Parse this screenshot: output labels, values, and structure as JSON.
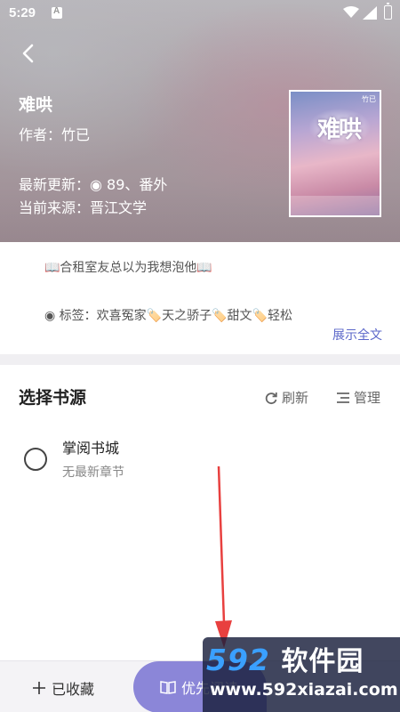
{
  "status_bar": {
    "time": "5:29"
  },
  "book": {
    "title": "难哄",
    "author_line": "作者：竹已",
    "latest_update": "最新更新：◉ 89、番外",
    "current_source": "当前来源：晋江文学",
    "cover_tag": "竹已"
  },
  "description": {
    "intro": "📖合租室友总以为我想泡他📖",
    "tags": "◉ 标签：欢喜冤家🏷️天之骄子🏷️甜文🏷️轻松",
    "expand_label": "展示全文"
  },
  "source_section": {
    "title": "选择书源",
    "refresh_label": "刷新",
    "manage_label": "管理",
    "items": [
      {
        "name": "掌阅书城",
        "chapter": "无最新章节",
        "selected": false
      }
    ]
  },
  "bottom_bar": {
    "collected_label": "已收藏",
    "read_label": "优先阅读"
  },
  "watermark": {
    "brand_number": "592",
    "brand_text": "软件园",
    "url": "www.592xiazai.com"
  },
  "colors": {
    "accent": "#8b86d8",
    "link": "#5b67c9",
    "arrow": "#e8403f"
  }
}
